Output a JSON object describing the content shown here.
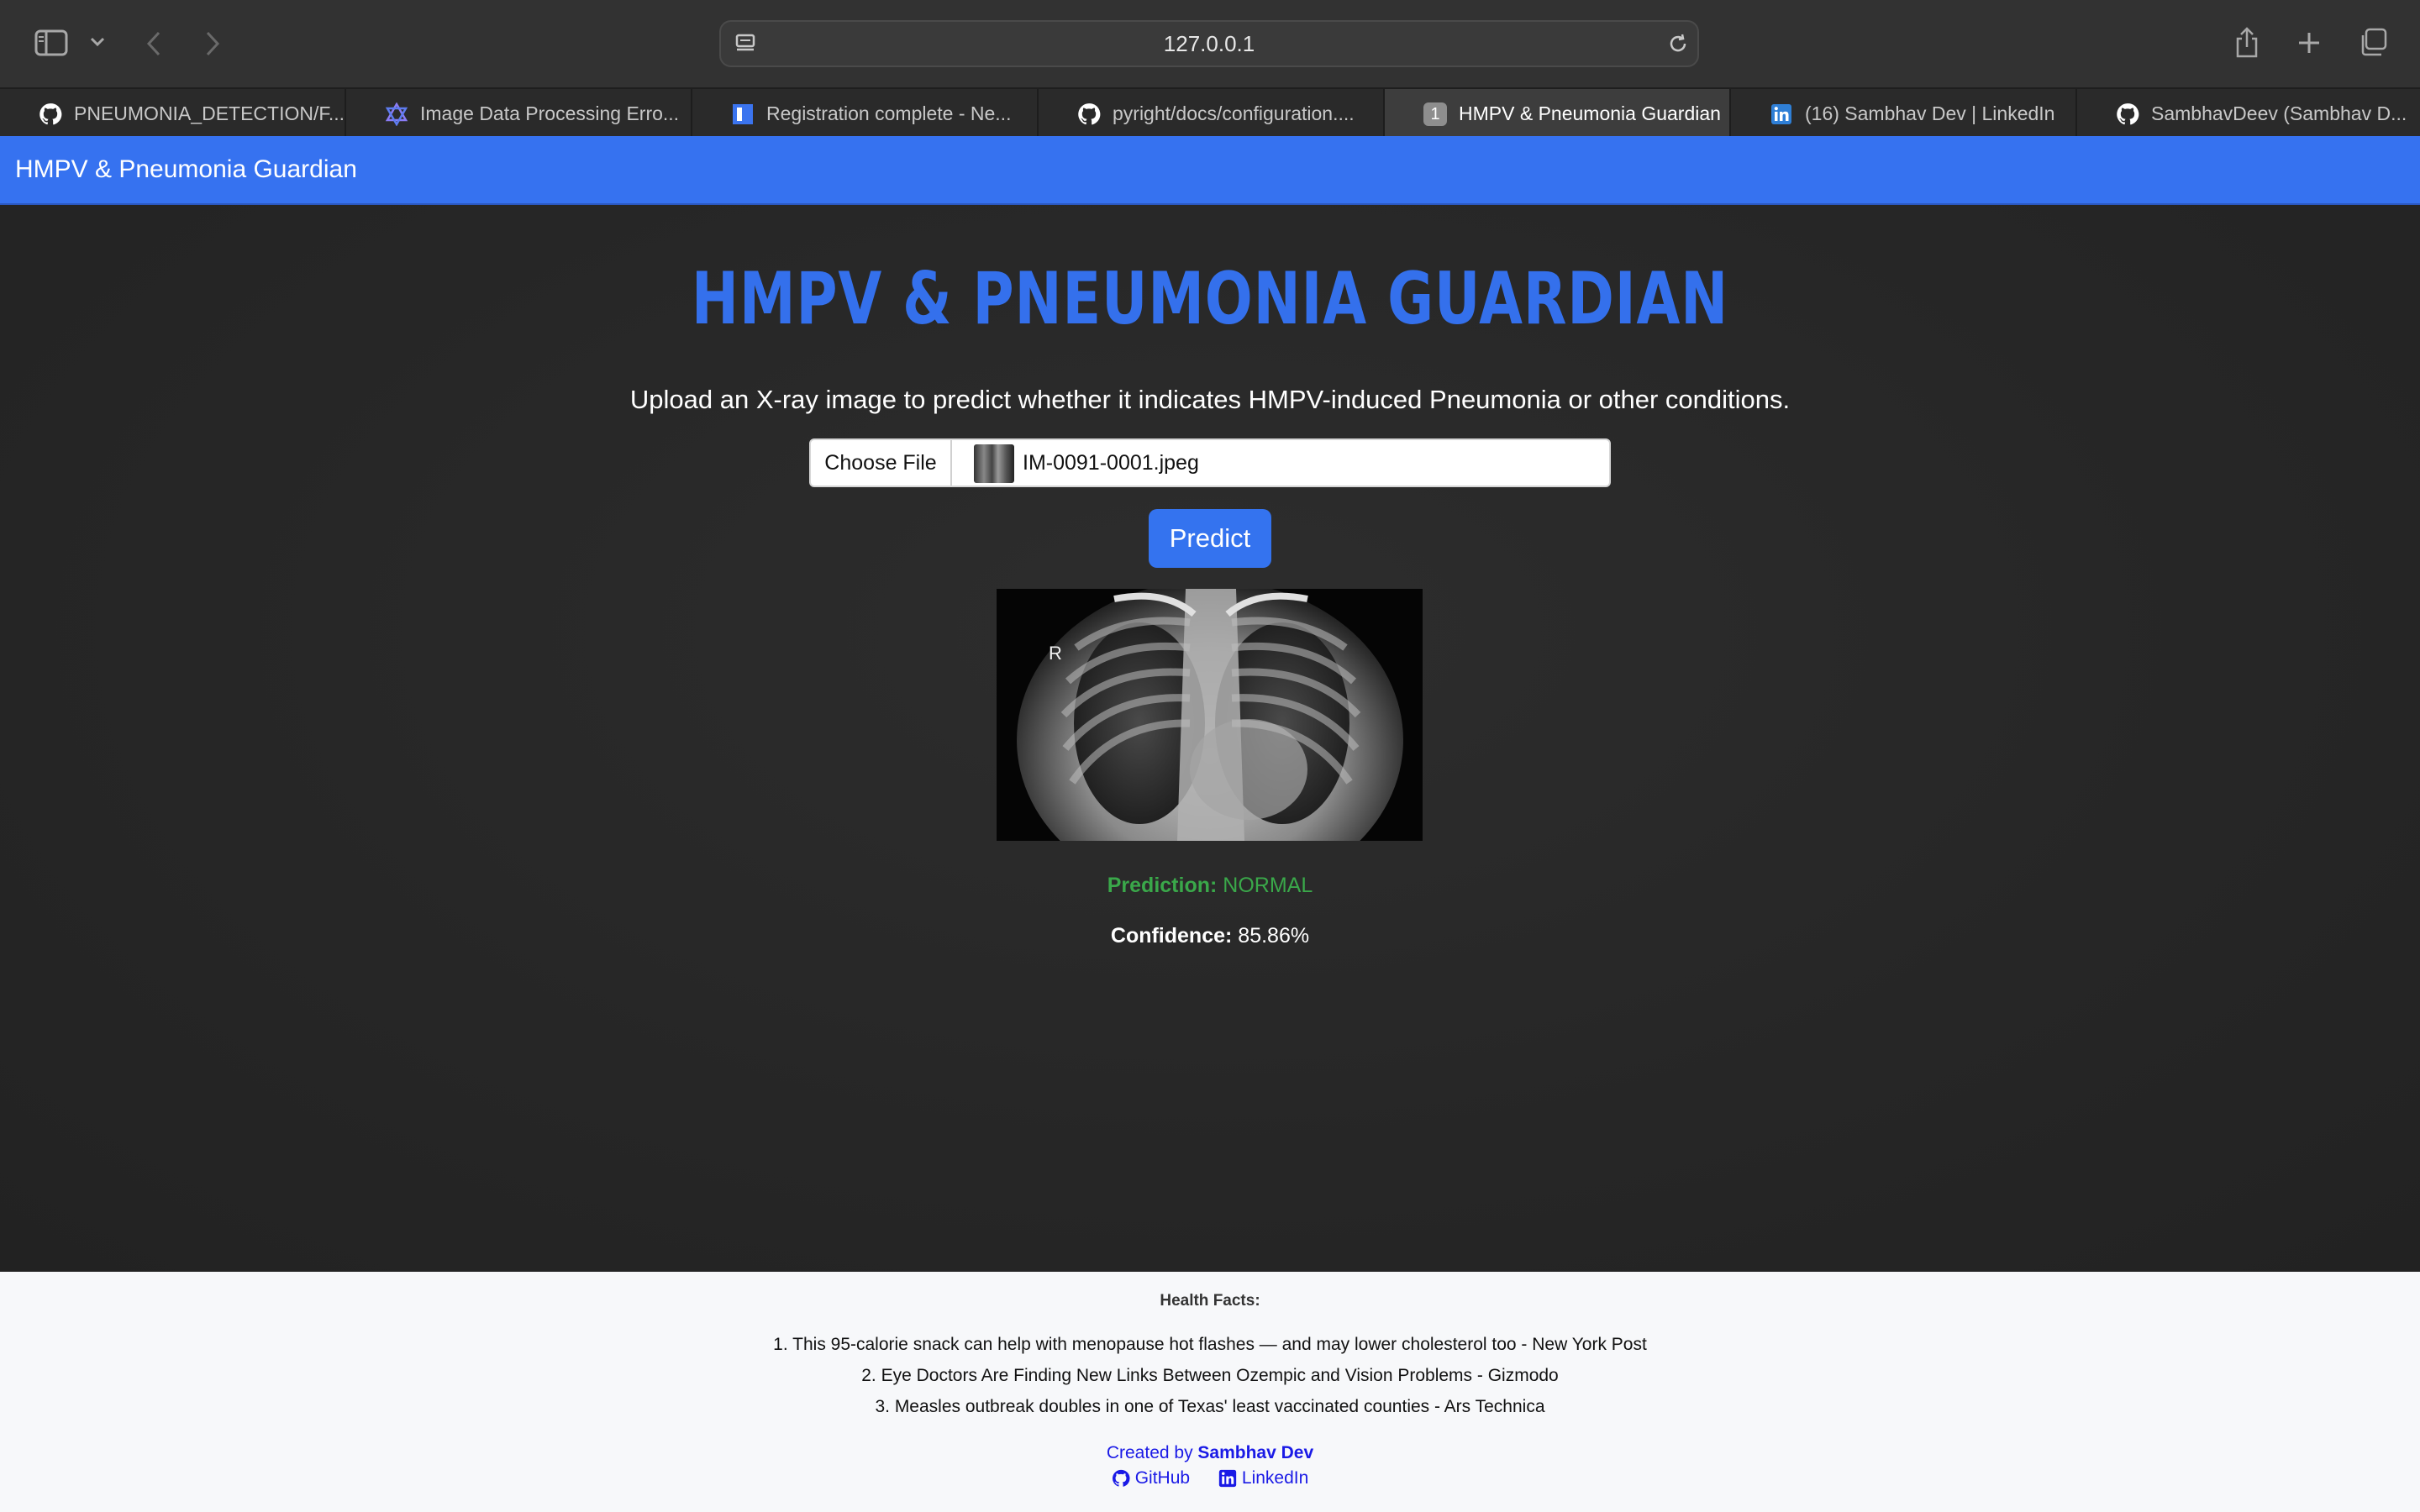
{
  "browser": {
    "url": "127.0.0.1",
    "tabs": [
      {
        "label": "PNEUMONIA_DETECTION/F...",
        "icon": "github-icon"
      },
      {
        "label": "Image Data Processing Erro...",
        "icon": "star-of-david-icon"
      },
      {
        "label": "Registration complete - Ne...",
        "icon": "notion-icon"
      },
      {
        "label": "pyright/docs/configuration....",
        "icon": "github-icon"
      },
      {
        "label": "HMPV & Pneumonia Guardian",
        "icon": "tab-number-badge",
        "badge": "1",
        "active": true
      },
      {
        "label": "(16) Sambhav Dev | LinkedIn",
        "icon": "linkedin-icon"
      },
      {
        "label": "SambhavDeev (Sambhav D...",
        "icon": "github-icon"
      }
    ]
  },
  "nav": {
    "title": "HMPV & Pneumonia Guardian"
  },
  "hero": {
    "title": "HMPV & PNEUMONIA GUARDIAN",
    "subtitle": "Upload an X-ray image to predict whether it indicates HMPV-induced Pneumonia or other conditions."
  },
  "upload": {
    "choose_label": "Choose File",
    "file_name": "IM-0091-0001.jpeg",
    "predict_label": "Predict"
  },
  "xray": {
    "marker": "R"
  },
  "result": {
    "prediction_label": "Prediction:",
    "prediction_value": "NORMAL",
    "confidence_label": "Confidence:",
    "confidence_value": "85.86%"
  },
  "footer": {
    "facts_title": "Health Facts:",
    "facts": [
      "1. This 95-calorie snack can help with menopause hot flashes — and may lower cholesterol too - New York Post",
      "2. Eye Doctors Are Finding New Links Between Ozempic and Vision Problems - Gizmodo",
      "3. Measles outbreak doubles in one of Texas' least vaccinated counties - Ars Technica"
    ],
    "created_prefix": "Created by",
    "author": "Sambhav Dev",
    "github_label": "GitHub",
    "linkedin_label": "LinkedIn"
  },
  "colors": {
    "accent": "#3672f0",
    "prediction": "#3aa84a",
    "footer_link": "#1a1ae6"
  }
}
